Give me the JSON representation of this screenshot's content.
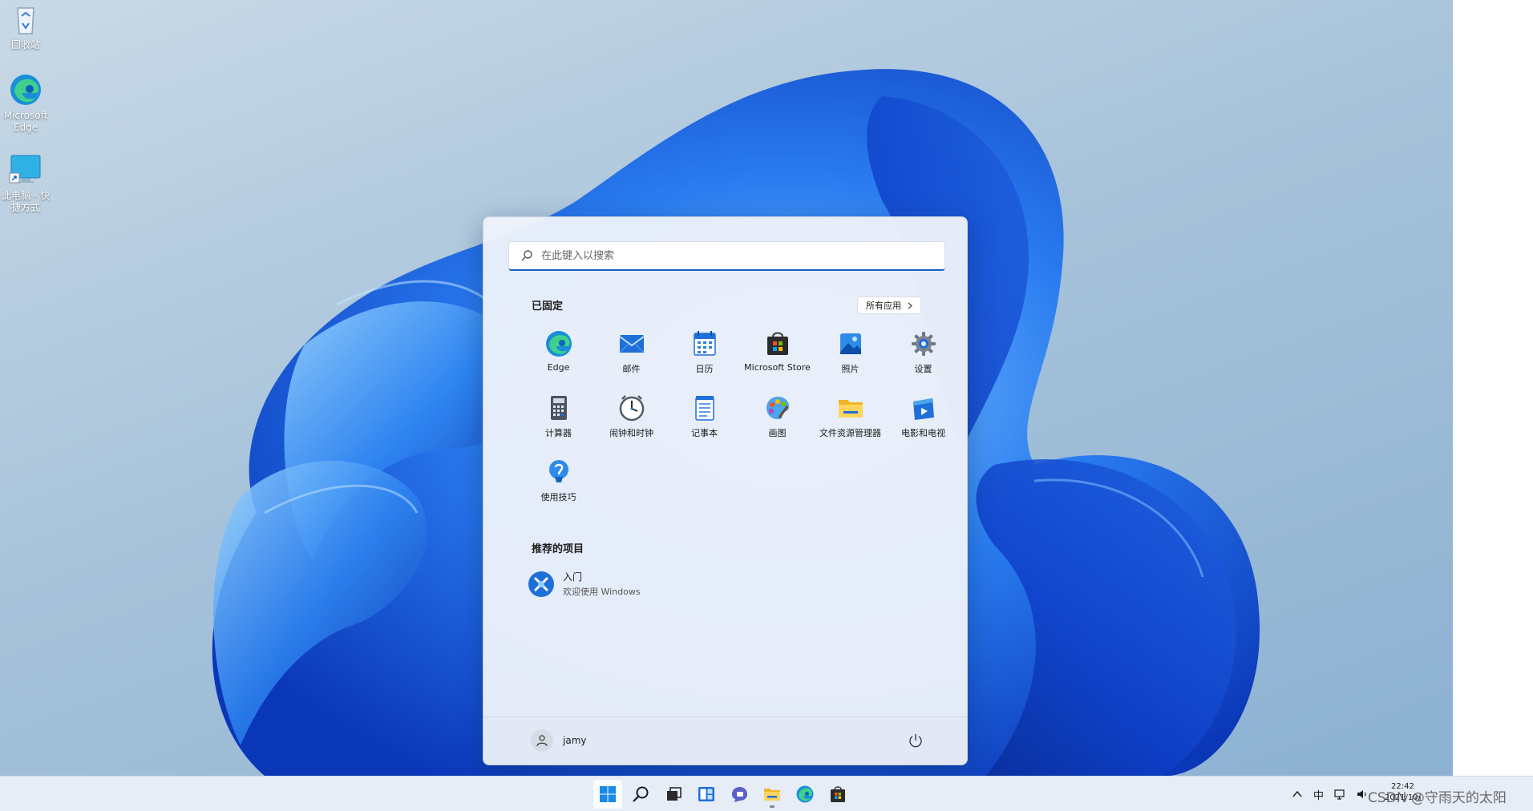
{
  "colors": {
    "accent": "#1561c4",
    "menu_background": "#ecf1fa",
    "taskbar_background": "#e7edf6",
    "bloom_blue": "#1a66e6"
  },
  "desktop": {
    "icons": [
      {
        "label": "回收站",
        "icon": "recycle-bin-icon"
      },
      {
        "label": "Microsoft Edge",
        "icon": "edge-icon"
      },
      {
        "label": "此电脑 - 快捷方式",
        "icon": "this-pc-shortcut-icon"
      }
    ]
  },
  "start_menu": {
    "search": {
      "placeholder": "在此键入以搜索",
      "value": ""
    },
    "pinned": {
      "title": "已固定",
      "all_apps_label": "所有应用",
      "apps": [
        {
          "label": "Edge",
          "icon": "edge-icon"
        },
        {
          "label": "邮件",
          "icon": "mail-icon"
        },
        {
          "label": "日历",
          "icon": "calendar-icon"
        },
        {
          "label": "Microsoft Store",
          "icon": "store-icon"
        },
        {
          "label": "照片",
          "icon": "photos-icon"
        },
        {
          "label": "设置",
          "icon": "settings-gear-icon"
        },
        {
          "label": "计算器",
          "icon": "calculator-icon"
        },
        {
          "label": "闹钟和时钟",
          "icon": "alarm-clock-icon"
        },
        {
          "label": "记事本",
          "icon": "notepad-icon"
        },
        {
          "label": "画图",
          "icon": "paint-palette-icon"
        },
        {
          "label": "文件资源管理器",
          "icon": "file-explorer-folder-icon"
        },
        {
          "label": "电影和电视",
          "icon": "movies-tv-icon"
        },
        {
          "label": "使用技巧",
          "icon": "tips-lightbulb-icon"
        }
      ]
    },
    "recommended": {
      "title": "推荐的项目",
      "items": [
        {
          "title": "入门",
          "subtitle": "欢迎使用 Windows",
          "icon": "get-started-icon"
        }
      ]
    },
    "footer": {
      "user_name": "jamy",
      "user_icon": "user-avatar-icon",
      "power_icon": "power-icon"
    }
  },
  "taskbar": {
    "apps": [
      {
        "name": "start",
        "icon": "windows-start-icon",
        "active": true,
        "running": false
      },
      {
        "name": "search",
        "icon": "search-icon",
        "active": false,
        "running": false
      },
      {
        "name": "task-view",
        "icon": "task-view-icon",
        "active": false,
        "running": false
      },
      {
        "name": "widgets",
        "icon": "widgets-icon",
        "active": false,
        "running": false
      },
      {
        "name": "chat",
        "icon": "teams-chat-icon",
        "active": false,
        "running": false
      },
      {
        "name": "file-explorer",
        "icon": "file-explorer-folder-icon",
        "active": false,
        "running": true
      },
      {
        "name": "edge",
        "icon": "edge-icon",
        "active": false,
        "running": false
      },
      {
        "name": "store",
        "icon": "store-icon",
        "active": false,
        "running": false
      }
    ],
    "tray": {
      "chevron_icon": "chevron-up-icon",
      "ime_label": "中",
      "network_icon": "network-icon",
      "volume_icon": "volume-icon"
    },
    "clock": {
      "time": "22:42",
      "date": "2021/10/"
    }
  },
  "watermark": "CSDN @守雨天的太阳"
}
